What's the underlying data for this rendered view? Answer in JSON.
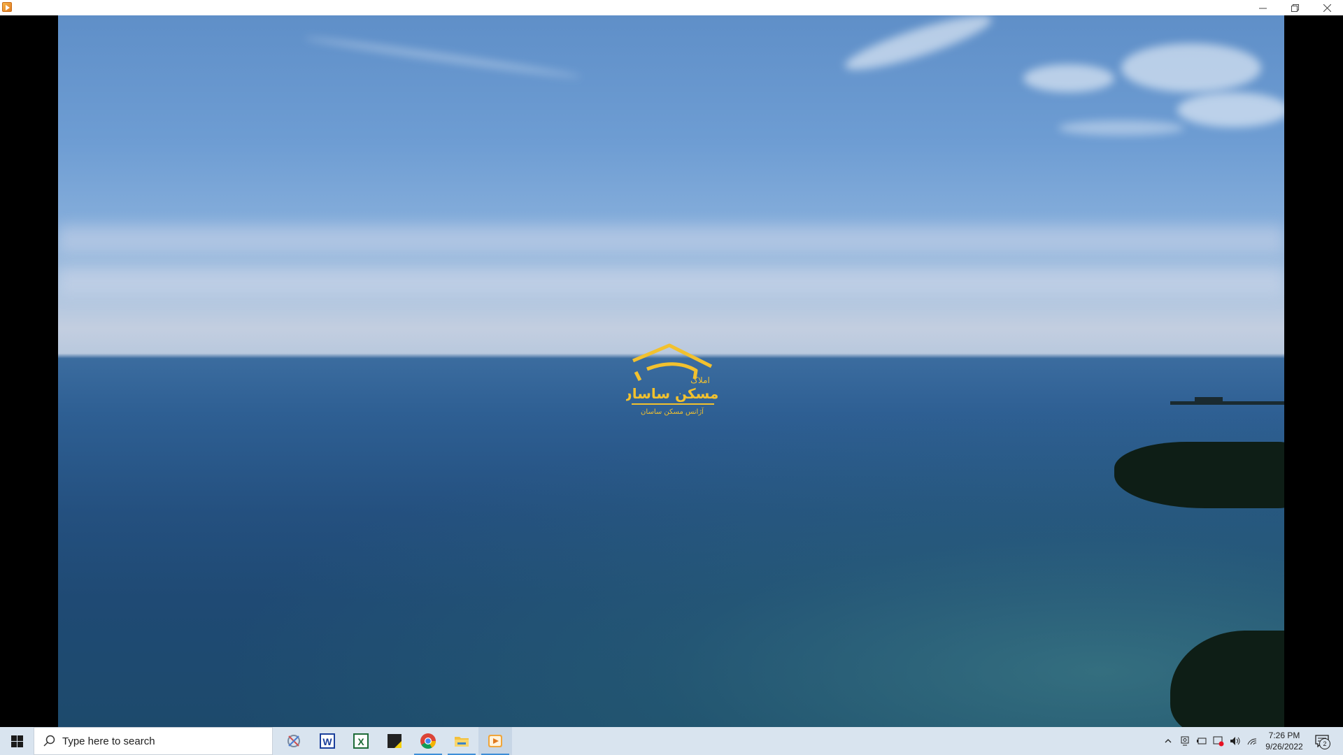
{
  "window": {
    "app_icon": "media-player-icon",
    "controls": [
      "minimize-icon",
      "restore-icon",
      "close-icon"
    ]
  },
  "video": {
    "logo": {
      "line1": "املاک",
      "line2": "مسکن ساسان",
      "line3": "آژانس مسکن ساسان"
    }
  },
  "taskbar": {
    "search_placeholder": "Type here to search",
    "apps": [
      "snipping-tool-icon",
      "word-icon",
      "excel-icon",
      "sticky-notes-icon",
      "chrome-icon",
      "file-explorer-icon",
      "media-player-icon"
    ],
    "clock": {
      "time": "7:26 PM",
      "date": "9/26/2022"
    },
    "notification_count": "2"
  },
  "colors": {
    "taskbar_bg": "#d9e4ef",
    "logo_gold": "#f2c12e",
    "active_underline": "#3d8ed8"
  }
}
